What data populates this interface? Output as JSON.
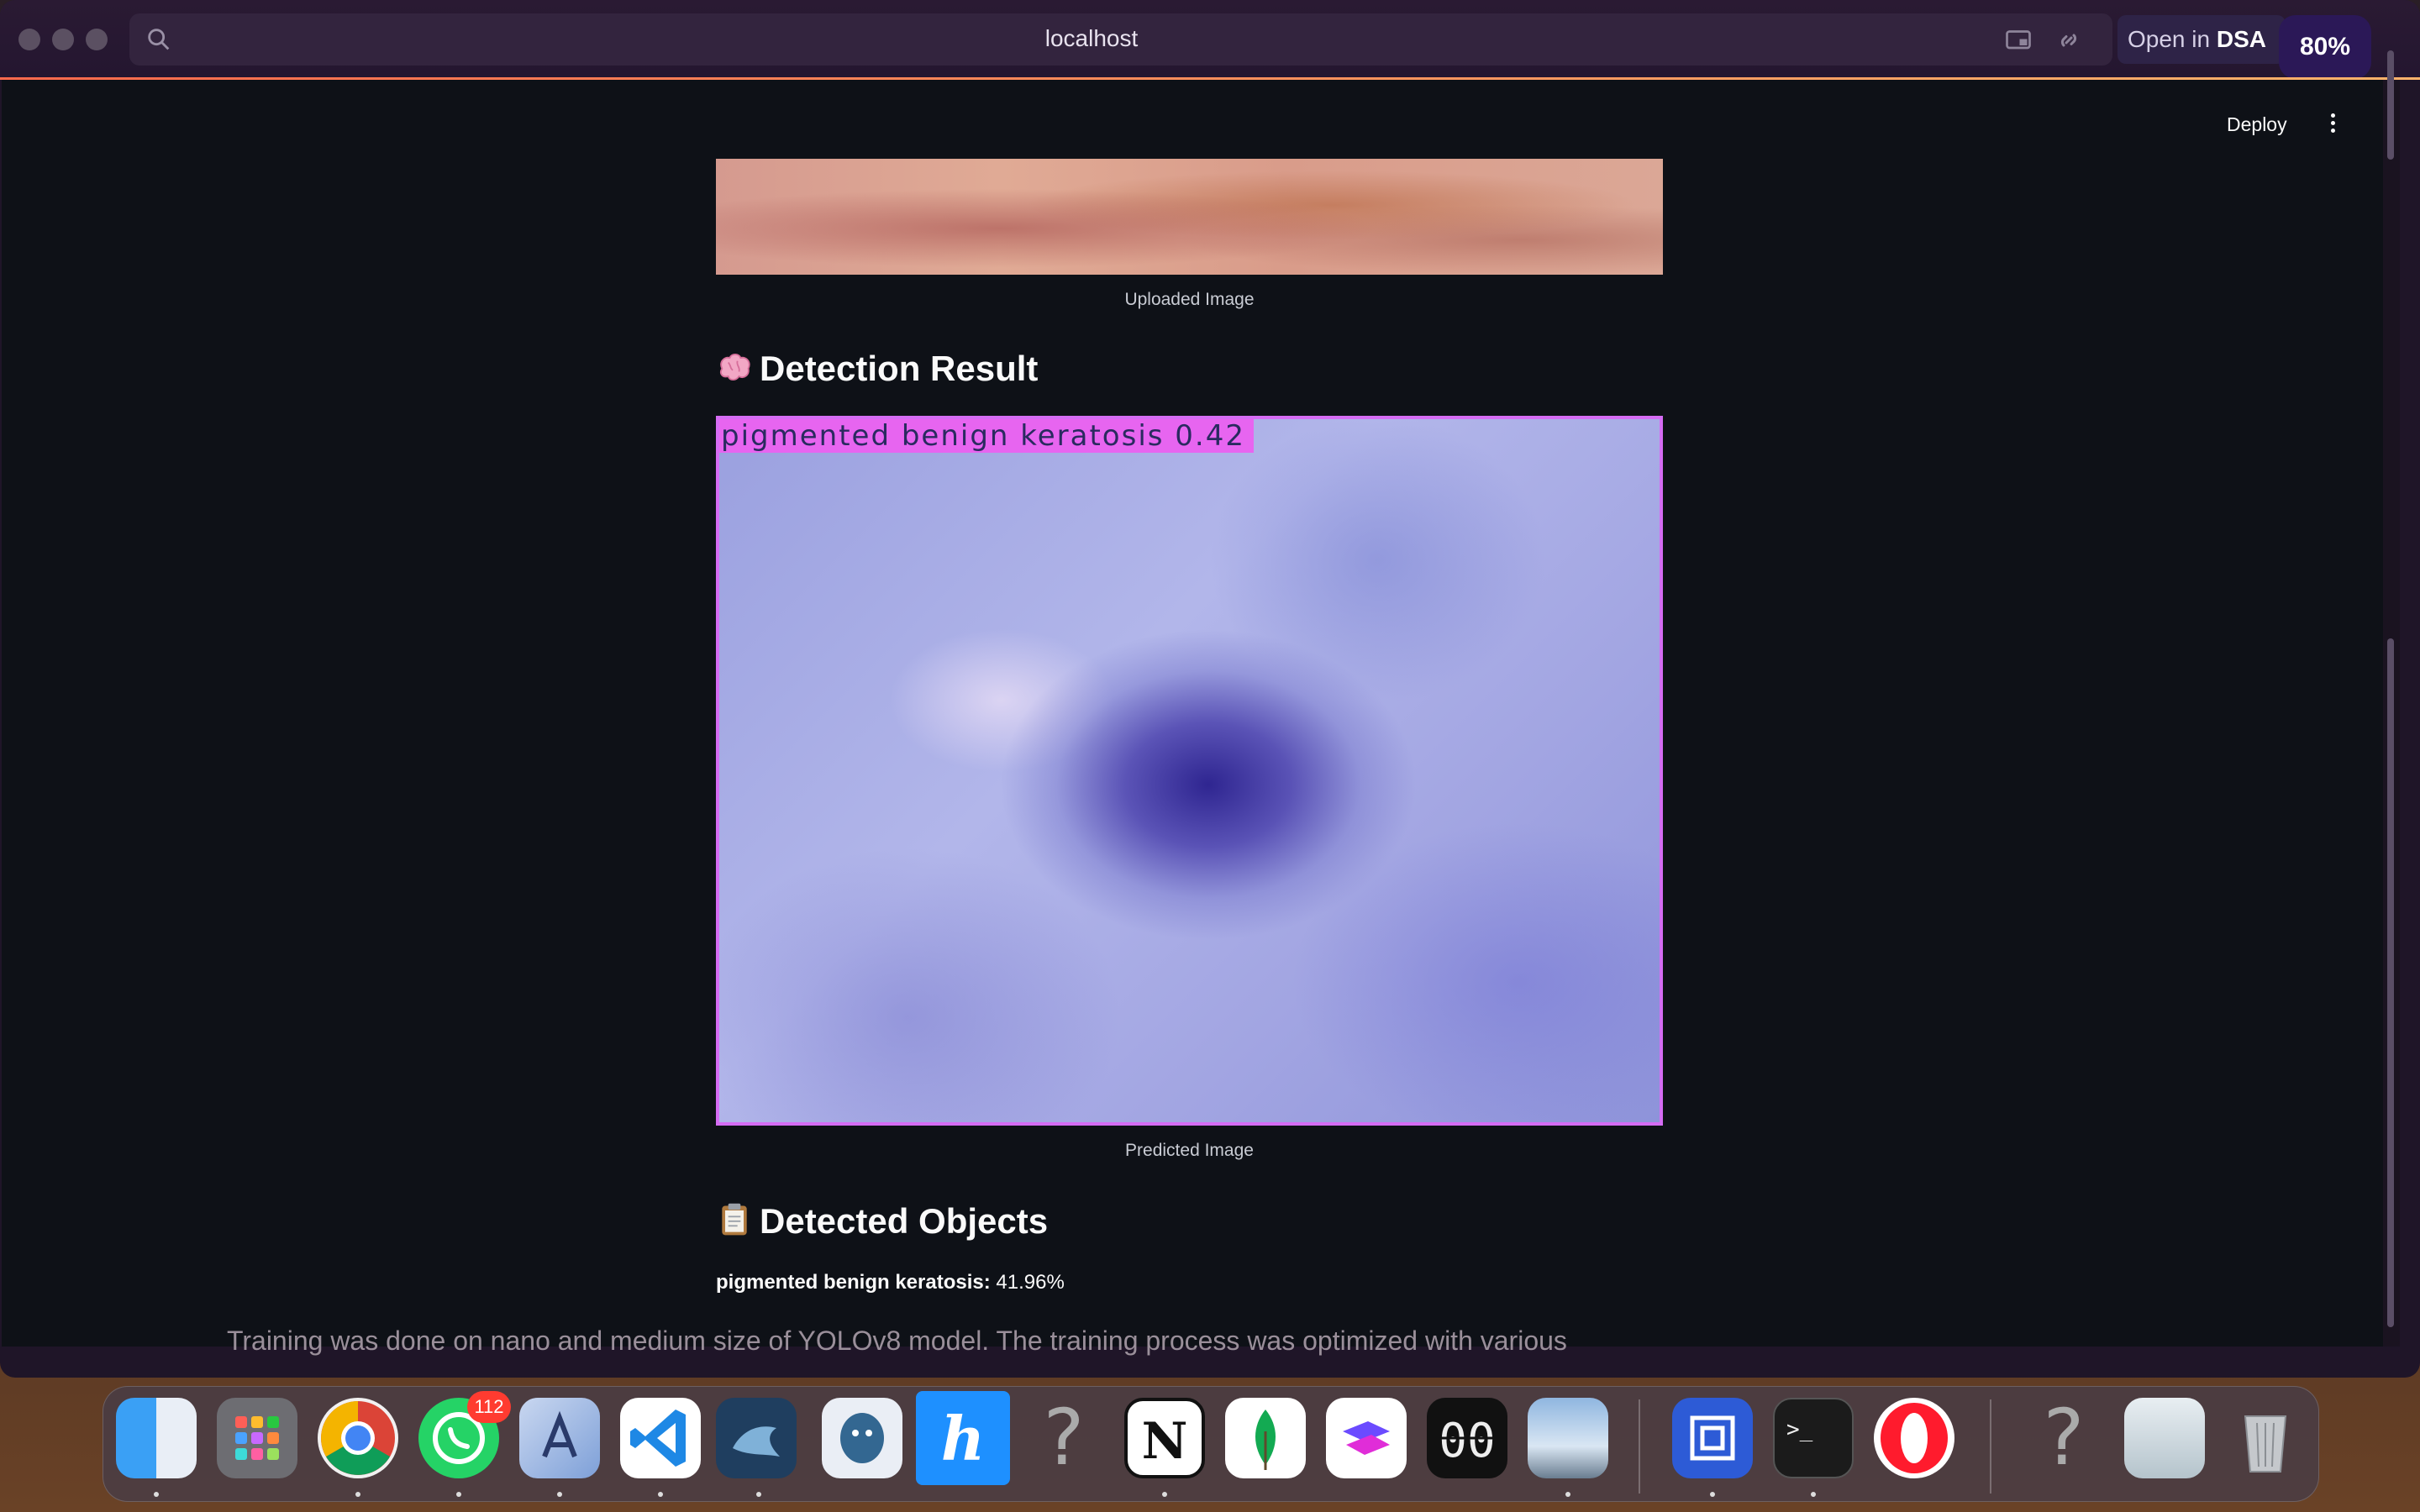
{
  "browser": {
    "url": "localhost",
    "open_in_label_prefix": "Open in ",
    "open_in_label_app": "DSA",
    "zoom": "80%"
  },
  "app": {
    "deploy_label": "Deploy",
    "uploaded_caption": "Uploaded Image",
    "detection_title": "Detection Result",
    "detection_emoji": "brain-emoji",
    "prediction_overlay_label": "pigmented benign keratosis 0.42",
    "predicted_caption": "Predicted Image",
    "detected_objects_title": "Detected Objects",
    "detected_objects_emoji": "clipboard-emoji",
    "detected_object_name": "pigmented benign keratosis:",
    "detected_object_value": "41.96%"
  },
  "behind_window_text": "Training was done on nano and medium size of YOLOv8 model. The training process was optimized with various",
  "dock": {
    "items": [
      "finder-icon",
      "launchpad-icon",
      "chrome-icon",
      "whatsapp-icon",
      "ai-app-icon",
      "vscode-icon",
      "mysql-workbench-icon",
      "pgadmin-icon",
      "hyper-icon",
      "unknown-app-icon",
      "notion-icon",
      "mongodb-icon",
      "app-icon",
      "clock-app-icon",
      "preview-icon",
      "screenshot-app-icon",
      "terminal-icon",
      "opera-icon",
      "unknown-app-icon",
      "documents-icon",
      "trash-icon"
    ],
    "whatsapp_badge": "112"
  },
  "colors": {
    "app_bg": "#0e1117",
    "box_outline": "#d56cf4",
    "label_bg": "#e765f0"
  }
}
